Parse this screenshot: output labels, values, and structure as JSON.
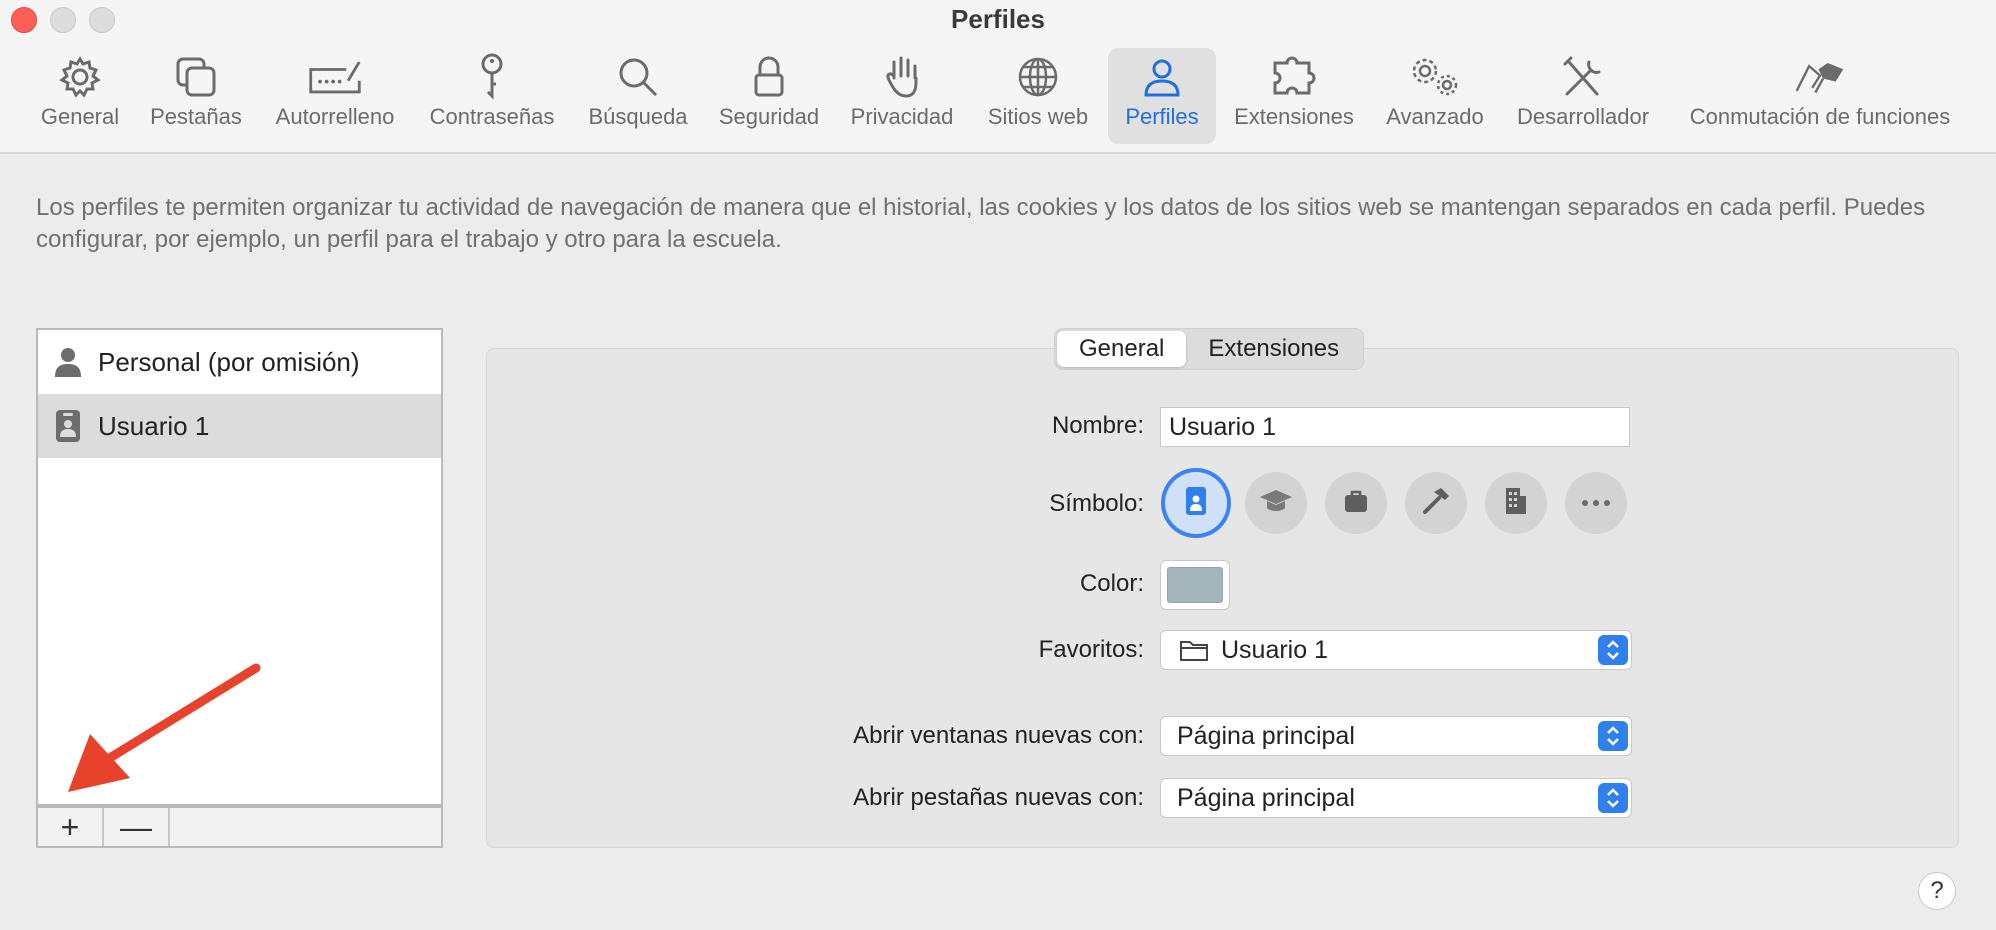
{
  "window": {
    "title": "Perfiles"
  },
  "toolbar": {
    "items": [
      {
        "label": "General",
        "icon": "gear-icon"
      },
      {
        "label": "Pestañas",
        "icon": "tabs-icon"
      },
      {
        "label": "Autorrelleno",
        "icon": "autofill-icon"
      },
      {
        "label": "Contraseñas",
        "icon": "key-icon"
      },
      {
        "label": "Búsqueda",
        "icon": "search-icon"
      },
      {
        "label": "Seguridad",
        "icon": "lock-icon"
      },
      {
        "label": "Privacidad",
        "icon": "hand-icon"
      },
      {
        "label": "Sitios web",
        "icon": "globe-icon"
      },
      {
        "label": "Perfiles",
        "icon": "person-icon"
      },
      {
        "label": "Extensiones",
        "icon": "puzzle-icon"
      },
      {
        "label": "Avanzado",
        "icon": "gears-icon"
      },
      {
        "label": "Desarrollador",
        "icon": "tools-icon"
      },
      {
        "label": "Conmutación de funciones",
        "icon": "flags-icon"
      }
    ],
    "active": "Perfiles"
  },
  "description": "Los perfiles te permiten organizar tu actividad de navegación de manera que el historial, las cookies y los datos de los sitios web se mantengan separados en cada perfil. Puedes configurar, por ejemplo, un perfil para el trabajo y otro para la escuela.",
  "profiles": {
    "items": [
      {
        "label": "Personal (por omisión)",
        "icon": "person-icon",
        "selected": false
      },
      {
        "label": "Usuario 1",
        "icon": "badge-icon",
        "selected": true
      }
    ],
    "add_label": "+",
    "remove_label": "—"
  },
  "tabs": {
    "items": [
      {
        "label": "General",
        "selected": true
      },
      {
        "label": "Extensiones",
        "selected": false
      }
    ]
  },
  "form": {
    "name_label": "Nombre:",
    "name_value": "Usuario 1",
    "symbol_label": "Símbolo:",
    "symbols": [
      "badge-icon",
      "graduation-cap-icon",
      "briefcase-icon",
      "hammer-icon",
      "building-icon",
      "more-icon"
    ],
    "symbol_selected": "badge-icon",
    "color_label": "Color:",
    "color_value": "#a4b4bb",
    "favorites_label": "Favoritos:",
    "favorites_value": "Usuario 1",
    "new_windows_label": "Abrir ventanas nuevas con:",
    "new_windows_value": "Página principal",
    "new_tabs_label": "Abrir pestañas nuevas con:",
    "new_tabs_value": "Página principal"
  },
  "help_label": "?",
  "colors": {
    "accent": "#1f6fde",
    "annotation_arrow": "#e8412c"
  }
}
